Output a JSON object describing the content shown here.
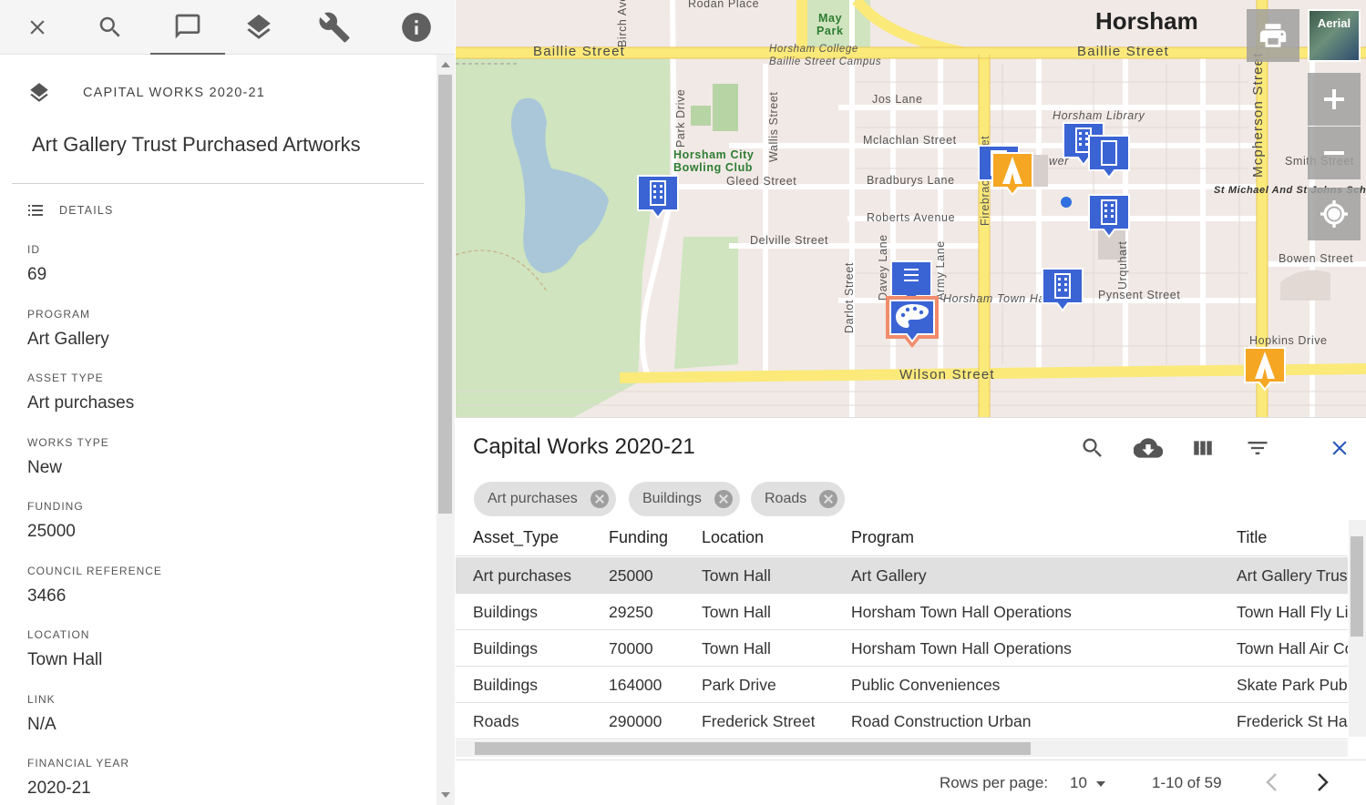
{
  "toolbar": {
    "buttons": [
      "close-icon",
      "search-icon",
      "feature-info-icon",
      "layers-icon",
      "tools-icon",
      "info-icon"
    ],
    "active": "feature-info-icon"
  },
  "panel": {
    "layer_title": "CAPITAL WORKS 2020-21",
    "feature_title": "Art Gallery Trust Purchased Artworks",
    "details_label": "DETAILS",
    "fields": [
      {
        "key": "ID",
        "value": "69"
      },
      {
        "key": "PROGRAM",
        "value": "Art Gallery"
      },
      {
        "key": "ASSET TYPE",
        "value": "Art purchases"
      },
      {
        "key": "WORKS TYPE",
        "value": "New"
      },
      {
        "key": "FUNDING",
        "value": "25000"
      },
      {
        "key": "COUNCIL REFERENCE",
        "value": "3466"
      },
      {
        "key": "LOCATION",
        "value": "Town Hall"
      },
      {
        "key": "LINK",
        "value": "N/A"
      },
      {
        "key": "FINANCIAL YEAR",
        "value": "2020-21"
      }
    ]
  },
  "map": {
    "city": "Horsham",
    "basemap_label": "Aerial",
    "labels": {
      "rodan_place": "Rodan Place",
      "may_park_1": "May",
      "may_park_2": "Park",
      "baillie_street_w": "Baillie Street",
      "baillie_street_e": "Baillie Street",
      "college_1": "Horsham College",
      "college_2": "Baillie Street Campus",
      "birch_ave": "Birch Ave",
      "park_drive": "Park Drive",
      "wallis_street": "Wallis Street",
      "jos_lane": "Jos Lane",
      "mclachlan_street": "Mclachlan Street",
      "library": "Horsham Library",
      "bowling_1": "Horsham City",
      "bowling_2": "Bowling Club",
      "gleed_street": "Gleed Street",
      "bradburys_lane": "Bradburys Lane",
      "firebrace_street": "Firebrace Street",
      "roberts_avenue": "Roberts Avenue",
      "delville_street": "Delville Street",
      "davey_lane": "Davey Lane",
      "army_lane": "Army Lane",
      "darlot_street": "Darlot Street",
      "urquhart": "Urquhart",
      "town_hall": "Horsham Town Hall",
      "pynsent_street": "Pynsent Street",
      "wilson_street": "Wilson Street",
      "mcpherson_street": "Mcpherson Street",
      "smith_street": "Smith Street",
      "st_michael": "St Michael And St Johns Scho",
      "bowen_street": "Bowen Street",
      "hopkins_drive": "Hopkins Drive",
      "wer": "wer"
    },
    "colors": {
      "marker_blue": "#3a63d4",
      "marker_orange": "#f5a623",
      "selected_outline": "#f08c6c"
    }
  },
  "table": {
    "title": "Capital Works 2020-21",
    "actions": [
      "search-icon",
      "download-icon",
      "columns-icon",
      "filter-icon",
      "close-icon"
    ],
    "filters": [
      "Art purchases",
      "Buildings",
      "Roads"
    ],
    "columns": [
      "Asset_Type",
      "Funding",
      "Location",
      "Program",
      "Title"
    ],
    "rows": [
      [
        "Art purchases",
        "25000",
        "Town Hall",
        "Art Gallery",
        "Art Gallery Trust Purchased Artworks"
      ],
      [
        "Buildings",
        "29250",
        "Town Hall",
        "Horsham Town Hall Operations",
        "Town Hall Fly Line"
      ],
      [
        "Buildings",
        "70000",
        "Town Hall",
        "Horsham Town Hall Operations",
        "Town Hall Air Conditioning"
      ],
      [
        "Buildings",
        "164000",
        "Park Drive",
        "Public Conveniences",
        "Skate Park Public Toilets"
      ],
      [
        "Roads",
        "290000",
        "Frederick Street",
        "Road Construction Urban",
        "Frederick St Hamilton St"
      ]
    ],
    "selected_row": 0,
    "pager": {
      "rows_per_page_label": "Rows per page:",
      "rows_per_page": "10",
      "range": "1-10 of 59"
    }
  }
}
